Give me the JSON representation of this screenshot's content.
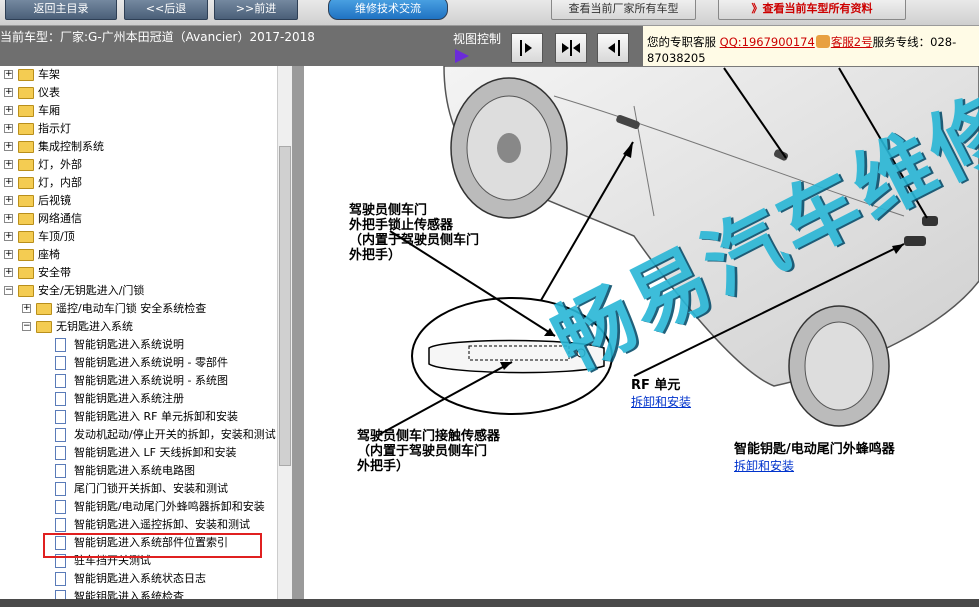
{
  "toolbar": {
    "home": "返回主目录",
    "back": "<<后退",
    "forward": ">>前进",
    "tech": "维修技术交流",
    "view_models": "查看当前厂家所有车型",
    "view_all": "》查看当前车型所有资料"
  },
  "info": {
    "model": "当前车型：厂家:G-广州本田冠道（Avancier）2017-2018",
    "view_control": "视图控制"
  },
  "service": {
    "label": "您的专职客服",
    "qq": "QQ:1967900174",
    "kf2": "客服2号",
    "hotline_label": "服务专线：028-",
    "hotline_cont": "87038205"
  },
  "tree": [
    {
      "label": "车架",
      "level": 0
    },
    {
      "label": "仪表",
      "level": 0
    },
    {
      "label": "车厢",
      "level": 0
    },
    {
      "label": "指示灯",
      "level": 0
    },
    {
      "label": "集成控制系统",
      "level": 0
    },
    {
      "label": "灯，外部",
      "level": 0
    },
    {
      "label": "灯，内部",
      "level": 0
    },
    {
      "label": "后视镜",
      "level": 0
    },
    {
      "label": "网络通信",
      "level": 0
    },
    {
      "label": "车顶/顶",
      "level": 0
    },
    {
      "label": "座椅",
      "level": 0
    },
    {
      "label": "安全带",
      "level": 0
    },
    {
      "label": "安全/无钥匙进入/门锁",
      "level": 0
    },
    {
      "label": "遥控/电动车门锁 安全系统检查",
      "level": 1
    },
    {
      "label": "无钥匙进入系统",
      "level": 1
    },
    {
      "label": "智能钥匙进入系统说明",
      "level": 2
    },
    {
      "label": "智能钥匙进入系统说明 - 零部件",
      "level": 2
    },
    {
      "label": "智能钥匙进入系统说明 - 系统图",
      "level": 2
    },
    {
      "label": "智能钥匙进入系统注册",
      "level": 2
    },
    {
      "label": "智能钥匙进入 RF 单元拆卸和安装",
      "level": 2
    },
    {
      "label": "发动机起动/停止开关的拆卸，安装和测试",
      "level": 2
    },
    {
      "label": "智能钥匙进入 LF 天线拆卸和安装",
      "level": 2
    },
    {
      "label": "智能钥匙进入系统电路图",
      "level": 2
    },
    {
      "label": "尾门门锁开关拆卸、安装和测试",
      "level": 2
    },
    {
      "label": "智能钥匙/电动尾门外蜂鸣器拆卸和安装",
      "level": 2
    },
    {
      "label": "智能钥匙进入遥控拆卸、安装和测试",
      "level": 2
    },
    {
      "label": "智能钥匙进入系统部件位置索引",
      "level": 2
    },
    {
      "label": "驻车挡开关测试",
      "level": 2
    },
    {
      "label": "智能钥匙进入系统状态日志",
      "level": 2
    },
    {
      "label": "智能钥匙进入系统检查",
      "level": 2
    }
  ],
  "diagram": {
    "cap1": [
      "驾驶员侧车门",
      "外把手锁止传感器",
      "（内置于驾驶员侧车门",
      "外把手）"
    ],
    "cap2": [
      "驾驶员侧车门接触传感器",
      "（内置于驾驶员侧车门",
      "外把手）"
    ],
    "rf_title": "RF 单元",
    "rf_link": "拆卸和安装",
    "buzzer_title": "智能钥匙/电动尾门外蜂鸣器",
    "buzzer_link": "拆卸和安装",
    "watermark": "畅易汽车维修"
  }
}
